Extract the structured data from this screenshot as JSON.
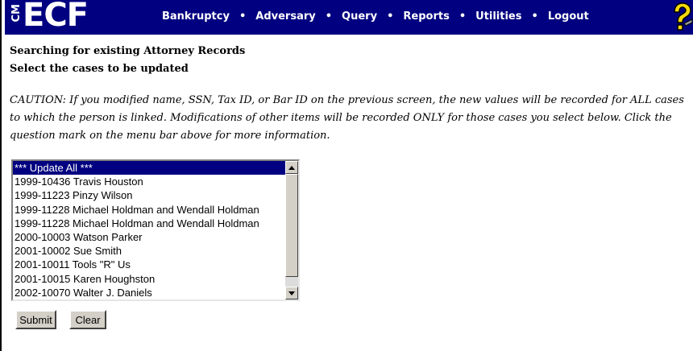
{
  "menubar": {
    "logo_cm": "CM",
    "logo_ecf": "ECF",
    "items": [
      "Bankruptcy",
      "Adversary",
      "Query",
      "Reports",
      "Utilities",
      "Logout"
    ],
    "separator": "•",
    "help_icon": "question-mark-help-icon",
    "background_color": "#000080"
  },
  "page": {
    "heading1": "Searching for existing Attorney Records",
    "heading2": "Select the cases to be updated",
    "caution": "CAUTION: If you modified name, SSN, Tax ID, or Bar ID on the previous screen, the new values will be recorded for ALL cases to which the person is linked. Modifications of other items will be recorded ONLY for those cases you select below. Click the question mark on the menu bar above for more information."
  },
  "case_list": {
    "items": [
      "*** Update All ***",
      "1999-10436 Travis Houston",
      "1999-11223 Pinzy Wilson",
      "1999-11228 Michael Holdman and Wendall Holdman",
      "1999-11228 Michael Holdman and Wendall Holdman",
      "2000-10003 Watson Parker",
      "2001-10002 Sue Smith",
      "2001-10011 Tools \"R\" Us",
      "2001-10015 Karen Houghston",
      "2002-10070 Walter J. Daniels"
    ],
    "selected_index": 0
  },
  "buttons": {
    "submit": "Submit",
    "clear": "Clear"
  }
}
